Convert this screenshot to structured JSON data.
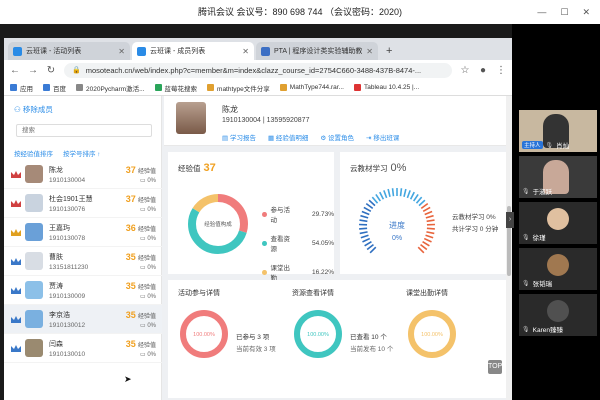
{
  "meeting": {
    "title": "腾讯会议 会议号：890 698 744 （会议密码：2020)"
  },
  "browser": {
    "tabs": [
      {
        "label": "云班课 - 活动列表",
        "active": false
      },
      {
        "label": "云班课 - 成员列表",
        "active": true
      },
      {
        "label": "PTA | 程序设计类实验辅助教学平",
        "active": false
      }
    ],
    "new_tab": "+",
    "url": "mosoteach.cn/web/index.php?c=member&m=index&clazz_course_id=2754C660-3488-437B-8474-...",
    "bookmarks": [
      "应用",
      "百度",
      "2020Pycharm激活...",
      "蓝莓花搜索",
      "mathtype文件分享",
      "MathType744.rar...",
      "Tableau 10.4.25 |..."
    ]
  },
  "left": {
    "remove_label": "移除成员",
    "search_placeholder": "搜索",
    "sort_exp": "按经验值排序",
    "sort_id": "按学号排序 ↑",
    "members": [
      {
        "name": "陈龙",
        "id": "1910130004",
        "score": "37",
        "unit": "经验值",
        "pct": "0%",
        "crown": "#d04040",
        "avatar": "#a68a78"
      },
      {
        "name": "杜会1901王慧",
        "id": "1910130076",
        "score": "37",
        "unit": "经验值",
        "pct": "0%",
        "crown": "#d04040",
        "avatar": "#c9d3df"
      },
      {
        "name": "王嘉玙",
        "id": "1910130078",
        "score": "36",
        "unit": "经验值",
        "pct": "0%",
        "crown": "#e0a020",
        "avatar": "#6aa0d8"
      },
      {
        "name": "曹肤",
        "id": "13151811230",
        "score": "35",
        "unit": "经验值",
        "pct": "0%",
        "crown": "#3a78c8",
        "avatar": "#d8dde4"
      },
      {
        "name": "贾涛",
        "id": "1910130009",
        "score": "35",
        "unit": "经验值",
        "pct": "0%",
        "crown": "#3a78c8",
        "avatar": "#8cc0e8"
      },
      {
        "name": "李京浩",
        "id": "1910130012",
        "score": "35",
        "unit": "经验值",
        "pct": "0%",
        "crown": "#3a78c8",
        "avatar": "#7ab0e0"
      },
      {
        "name": "闫森",
        "id": "1910130010",
        "score": "35",
        "unit": "经验值",
        "pct": "0%",
        "crown": "#3a78c8",
        "avatar": "#9a8a70"
      }
    ]
  },
  "profile": {
    "name": "陈龙",
    "id_phone": "1910130004 | 13595920877",
    "actions": [
      "学习报告",
      "经验值明细",
      "设置角色",
      "移出班课"
    ]
  },
  "exp_card": {
    "title": "经验值",
    "value": "37",
    "center_label": "经验值构成",
    "legend": [
      {
        "label": "参与活动",
        "pct": "29.73%",
        "value": 29.73,
        "color": "#f07c7c"
      },
      {
        "label": "查看资源",
        "value": 54.05,
        "pct": "54.05%",
        "color": "#3fc6c0"
      },
      {
        "label": "课堂出勤",
        "value": 16.22,
        "pct": "16.22%",
        "color": "#f4c26a"
      }
    ]
  },
  "study_card": {
    "title": "云教材学习",
    "value": "0%",
    "gauge_label": "进度",
    "gauge_value": "0%",
    "line1": "云教材学习 0%",
    "line2": "共计学习 0 分钟"
  },
  "details": [
    {
      "title": "活动参与详情",
      "ring": "100.00%",
      "color": "#f07c7c",
      "line1": "已参与 3 项",
      "line2": "当前有效 3 项"
    },
    {
      "title": "资源查看详情",
      "ring": "100.00%",
      "color": "#3fc6c0",
      "line1": "已查看 10 个",
      "line2": "当前发布 10 个"
    },
    {
      "title": "课堂出勤详情",
      "ring": "100.00%",
      "color": "#f4c26a",
      "line1": "",
      "line2": ""
    }
  ],
  "back_top": "TOP",
  "gallery": [
    {
      "name": "肖灿",
      "host": "主持人"
    },
    {
      "name": "于淑跃",
      "host": ""
    },
    {
      "name": "徐瑾",
      "host": ""
    },
    {
      "name": "张韬瑞",
      "host": ""
    },
    {
      "name": "Karen臻臻",
      "host": ""
    }
  ]
}
